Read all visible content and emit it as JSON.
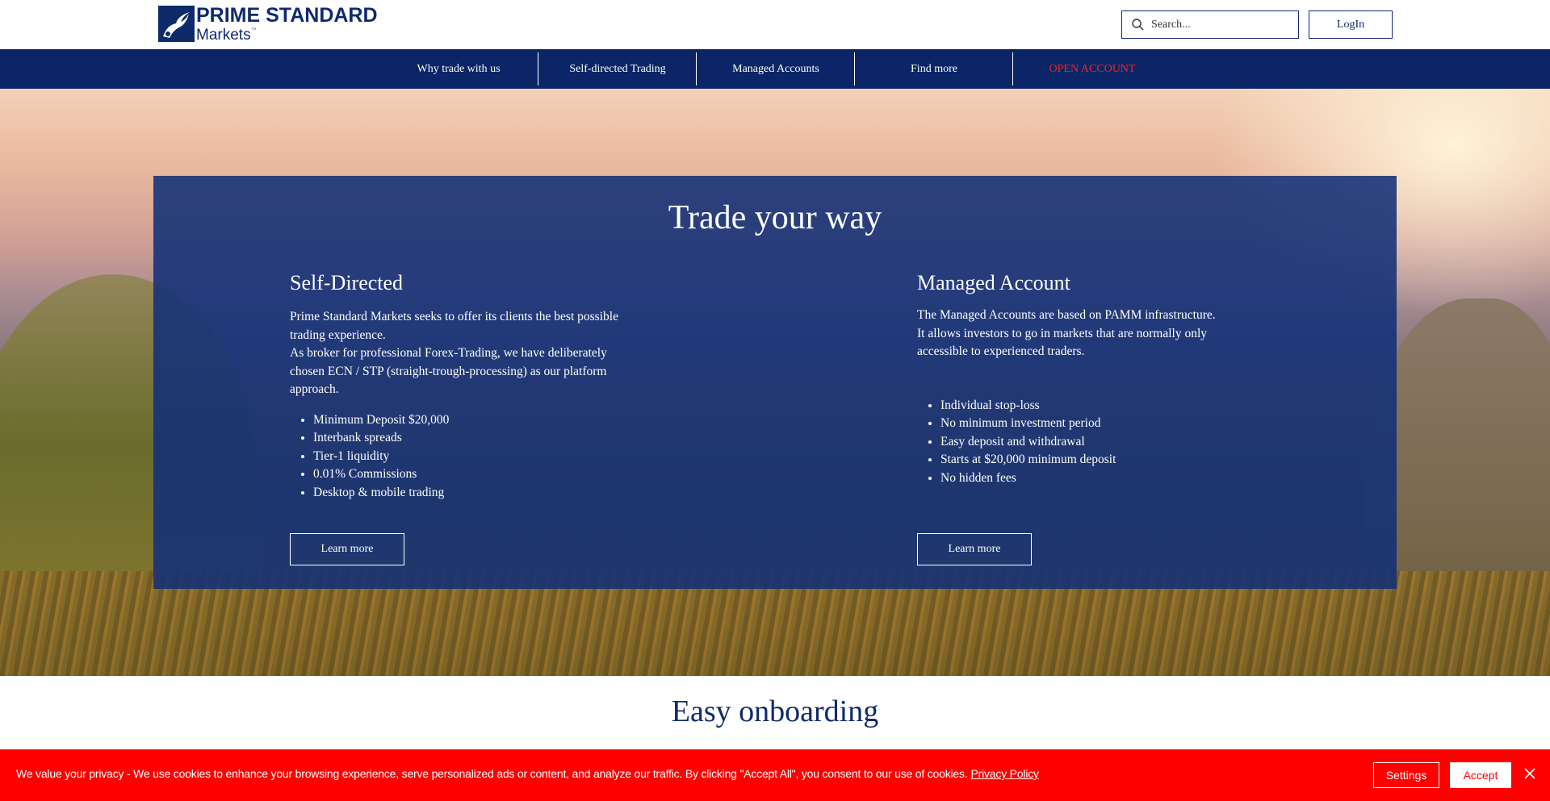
{
  "header": {
    "logo": {
      "line1": "PRIME STANDARD",
      "line2": "Markets",
      "tm": "™"
    },
    "search": {
      "placeholder": "Search..."
    },
    "login_label": "LogIn"
  },
  "nav": {
    "items": [
      {
        "label": "Why trade with us"
      },
      {
        "label": "Self-directed Trading"
      },
      {
        "label": "Managed Accounts"
      },
      {
        "label": "Find more"
      },
      {
        "label": "OPEN ACCOUNT"
      }
    ],
    "open_account_color": "#ff2020"
  },
  "hero": {
    "title": "Trade your way",
    "left": {
      "title": "Self-Directed",
      "paragraphs": [
        "Prime Standard Markets seeks to offer its clients the best possible trading experience.",
        "As broker for professional Forex-Trading, we have deliberately chosen ECN / STP (straight-trough-processing) as our platform approach."
      ],
      "bullets": [
        "Minimum Deposit $20,000",
        "Interbank spreads",
        "Tier-1 liquidity",
        "0.01% Commissions",
        "Desktop & mobile trading"
      ],
      "button": "Learn more"
    },
    "right": {
      "title": "Managed Account",
      "paragraphs": [
        "The Managed Accounts are based on PAMM infrastructure.",
        "It allows investors to go in markets that are normally only accessible to experienced traders."
      ],
      "bullets": [
        "Individual stop-loss",
        "No minimum investment period",
        "Easy deposit and withdrawal",
        "Starts at $20,000 minimum deposit",
        "No hidden fees"
      ],
      "button": "Learn more"
    }
  },
  "onboarding": {
    "title": "Easy onboarding"
  },
  "cookie": {
    "text": "We value your privacy - We use cookies to enhance your browsing experience, serve personalized ads or content, and analyze our traffic. By clicking \"Accept All\", you consent to our use of cookies.",
    "link": "Privacy Policy",
    "settings": "Settings",
    "accept": "Accept",
    "background": "#ff0000"
  },
  "colors": {
    "brand_navy": "#0b2566",
    "panel": "#123078"
  }
}
